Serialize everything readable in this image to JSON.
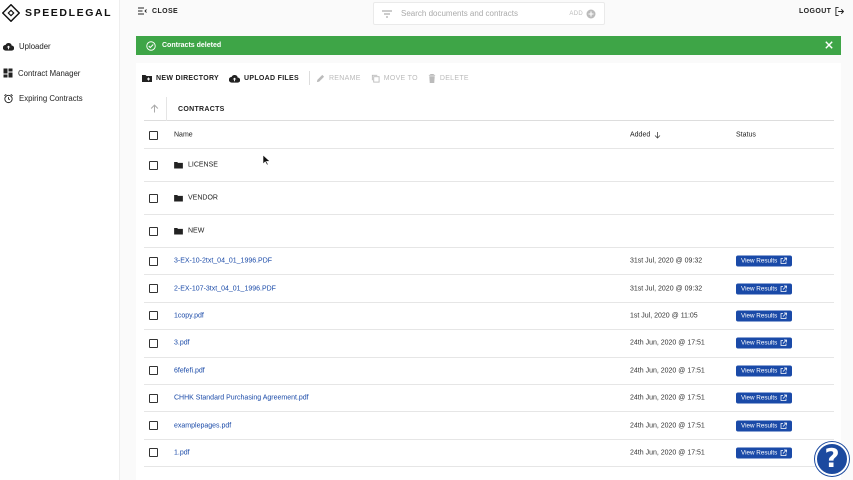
{
  "brand": {
    "name": "SPEEDLEGAL"
  },
  "sidebar": {
    "items": [
      {
        "label": "Uploader",
        "icon": "cloud-upload-icon"
      },
      {
        "label": "Contract Manager",
        "icon": "dashboard-icon"
      },
      {
        "label": "Expiring Contracts",
        "icon": "alarm-clock-icon"
      }
    ]
  },
  "topbar": {
    "close_label": "CLOSE",
    "search_placeholder": "Search documents and contracts",
    "add_label": "ADD",
    "logout_label": "LOGOUT"
  },
  "banner": {
    "message": "Contracts deleted",
    "color": "#3ea547"
  },
  "toolbar": {
    "new_directory": "NEW DIRECTORY",
    "upload_files": "UPLOAD FILES",
    "rename": "RENAME",
    "move_to": "MOVE TO",
    "delete": "DELETE"
  },
  "breadcrumb": {
    "label": "CONTRACTS"
  },
  "table": {
    "headers": {
      "name": "Name",
      "added": "Added",
      "status": "Status"
    },
    "folders": [
      "LICENSE",
      "VENDOR",
      "NEW"
    ],
    "files": [
      {
        "name": "3-EX-10-2txt_04_01_1996.PDF",
        "added": "31st Jul, 2020 @ 09:32",
        "status": "View Results"
      },
      {
        "name": "2-EX-107-3txt_04_01_1996.PDF",
        "added": "31st Jul, 2020 @ 09:32",
        "status": "View Results"
      },
      {
        "name": "1copy.pdf",
        "added": "1st Jul, 2020 @ 11:05",
        "status": "View Results"
      },
      {
        "name": "3.pdf",
        "added": "24th Jun, 2020 @ 17:51",
        "status": "View Results"
      },
      {
        "name": "6fefefi.pdf",
        "added": "24th Jun, 2020 @ 17:51",
        "status": "View Results"
      },
      {
        "name": "CHHK Standard Purchasing Agreement.pdf",
        "added": "24th Jun, 2020 @ 17:51",
        "status": "View Results"
      },
      {
        "name": "examplepages.pdf",
        "added": "24th Jun, 2020 @ 17:51",
        "status": "View Results"
      },
      {
        "name": "1.pdf",
        "added": "24th Jun, 2020 @ 17:51",
        "status": "View Results"
      }
    ]
  },
  "help": {
    "label": "?"
  },
  "colors": {
    "accent": "#1a4aa8",
    "success": "#3ea547"
  }
}
